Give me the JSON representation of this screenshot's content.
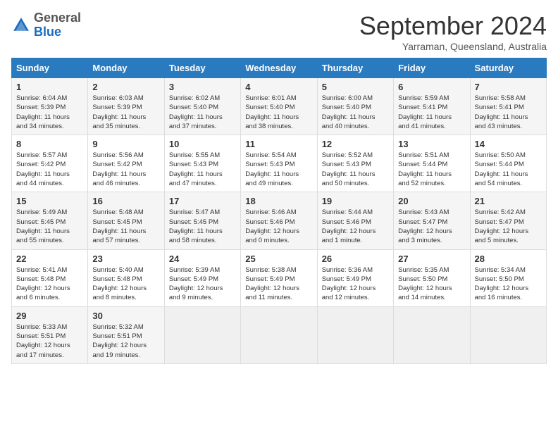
{
  "header": {
    "logo_general": "General",
    "logo_blue": "Blue",
    "month_title": "September 2024",
    "subtitle": "Yarraman, Queensland, Australia"
  },
  "days_of_week": [
    "Sunday",
    "Monday",
    "Tuesday",
    "Wednesday",
    "Thursday",
    "Friday",
    "Saturday"
  ],
  "weeks": [
    [
      {
        "day": "1",
        "info": "Sunrise: 6:04 AM\nSunset: 5:39 PM\nDaylight: 11 hours\nand 34 minutes."
      },
      {
        "day": "2",
        "info": "Sunrise: 6:03 AM\nSunset: 5:39 PM\nDaylight: 11 hours\nand 35 minutes."
      },
      {
        "day": "3",
        "info": "Sunrise: 6:02 AM\nSunset: 5:40 PM\nDaylight: 11 hours\nand 37 minutes."
      },
      {
        "day": "4",
        "info": "Sunrise: 6:01 AM\nSunset: 5:40 PM\nDaylight: 11 hours\nand 38 minutes."
      },
      {
        "day": "5",
        "info": "Sunrise: 6:00 AM\nSunset: 5:40 PM\nDaylight: 11 hours\nand 40 minutes."
      },
      {
        "day": "6",
        "info": "Sunrise: 5:59 AM\nSunset: 5:41 PM\nDaylight: 11 hours\nand 41 minutes."
      },
      {
        "day": "7",
        "info": "Sunrise: 5:58 AM\nSunset: 5:41 PM\nDaylight: 11 hours\nand 43 minutes."
      }
    ],
    [
      {
        "day": "8",
        "info": "Sunrise: 5:57 AM\nSunset: 5:42 PM\nDaylight: 11 hours\nand 44 minutes."
      },
      {
        "day": "9",
        "info": "Sunrise: 5:56 AM\nSunset: 5:42 PM\nDaylight: 11 hours\nand 46 minutes."
      },
      {
        "day": "10",
        "info": "Sunrise: 5:55 AM\nSunset: 5:43 PM\nDaylight: 11 hours\nand 47 minutes."
      },
      {
        "day": "11",
        "info": "Sunrise: 5:54 AM\nSunset: 5:43 PM\nDaylight: 11 hours\nand 49 minutes."
      },
      {
        "day": "12",
        "info": "Sunrise: 5:52 AM\nSunset: 5:43 PM\nDaylight: 11 hours\nand 50 minutes."
      },
      {
        "day": "13",
        "info": "Sunrise: 5:51 AM\nSunset: 5:44 PM\nDaylight: 11 hours\nand 52 minutes."
      },
      {
        "day": "14",
        "info": "Sunrise: 5:50 AM\nSunset: 5:44 PM\nDaylight: 11 hours\nand 54 minutes."
      }
    ],
    [
      {
        "day": "15",
        "info": "Sunrise: 5:49 AM\nSunset: 5:45 PM\nDaylight: 11 hours\nand 55 minutes."
      },
      {
        "day": "16",
        "info": "Sunrise: 5:48 AM\nSunset: 5:45 PM\nDaylight: 11 hours\nand 57 minutes."
      },
      {
        "day": "17",
        "info": "Sunrise: 5:47 AM\nSunset: 5:45 PM\nDaylight: 11 hours\nand 58 minutes."
      },
      {
        "day": "18",
        "info": "Sunrise: 5:46 AM\nSunset: 5:46 PM\nDaylight: 12 hours\nand 0 minutes."
      },
      {
        "day": "19",
        "info": "Sunrise: 5:44 AM\nSunset: 5:46 PM\nDaylight: 12 hours\nand 1 minute."
      },
      {
        "day": "20",
        "info": "Sunrise: 5:43 AM\nSunset: 5:47 PM\nDaylight: 12 hours\nand 3 minutes."
      },
      {
        "day": "21",
        "info": "Sunrise: 5:42 AM\nSunset: 5:47 PM\nDaylight: 12 hours\nand 5 minutes."
      }
    ],
    [
      {
        "day": "22",
        "info": "Sunrise: 5:41 AM\nSunset: 5:48 PM\nDaylight: 12 hours\nand 6 minutes."
      },
      {
        "day": "23",
        "info": "Sunrise: 5:40 AM\nSunset: 5:48 PM\nDaylight: 12 hours\nand 8 minutes."
      },
      {
        "day": "24",
        "info": "Sunrise: 5:39 AM\nSunset: 5:49 PM\nDaylight: 12 hours\nand 9 minutes."
      },
      {
        "day": "25",
        "info": "Sunrise: 5:38 AM\nSunset: 5:49 PM\nDaylight: 12 hours\nand 11 minutes."
      },
      {
        "day": "26",
        "info": "Sunrise: 5:36 AM\nSunset: 5:49 PM\nDaylight: 12 hours\nand 12 minutes."
      },
      {
        "day": "27",
        "info": "Sunrise: 5:35 AM\nSunset: 5:50 PM\nDaylight: 12 hours\nand 14 minutes."
      },
      {
        "day": "28",
        "info": "Sunrise: 5:34 AM\nSunset: 5:50 PM\nDaylight: 12 hours\nand 16 minutes."
      }
    ],
    [
      {
        "day": "29",
        "info": "Sunrise: 5:33 AM\nSunset: 5:51 PM\nDaylight: 12 hours\nand 17 minutes."
      },
      {
        "day": "30",
        "info": "Sunrise: 5:32 AM\nSunset: 5:51 PM\nDaylight: 12 hours\nand 19 minutes."
      },
      {
        "day": "",
        "info": ""
      },
      {
        "day": "",
        "info": ""
      },
      {
        "day": "",
        "info": ""
      },
      {
        "day": "",
        "info": ""
      },
      {
        "day": "",
        "info": ""
      }
    ]
  ]
}
